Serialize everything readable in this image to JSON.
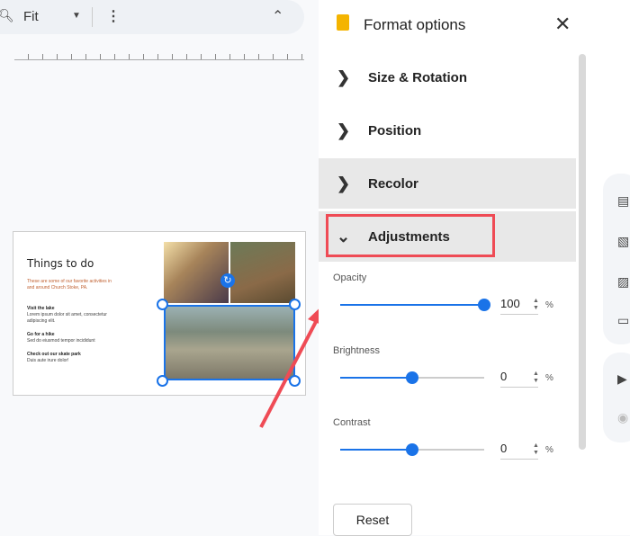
{
  "toolbar": {
    "zoom_label": "Fit"
  },
  "slide": {
    "title": "Things to do",
    "intro": "These are some of our favorite activities in and around Church Stoke, PA.",
    "items": [
      {
        "heading": "Visit the lake",
        "text": "Lorem ipsum dolor sit amet, consectetur adipiscing elit."
      },
      {
        "heading": "Go for a hike",
        "text": "Sed do eiusmod tempor incididunt"
      },
      {
        "heading": "Check out our skate park",
        "text": "Duis aute irure dolor!"
      }
    ]
  },
  "panel": {
    "title": "Format options",
    "sections": [
      "Size & Rotation",
      "Position",
      "Recolor",
      "Adjustments"
    ],
    "sliders": [
      {
        "label": "Opacity",
        "value": "100",
        "percent": 100,
        "unit": "%"
      },
      {
        "label": "Brightness",
        "value": "0",
        "percent": 50,
        "unit": "%"
      },
      {
        "label": "Contrast",
        "value": "0",
        "percent": 50,
        "unit": "%"
      }
    ],
    "reset_label": "Reset"
  },
  "colors": {
    "accent": "#1a73e8",
    "highlight": "#ef4b55"
  }
}
